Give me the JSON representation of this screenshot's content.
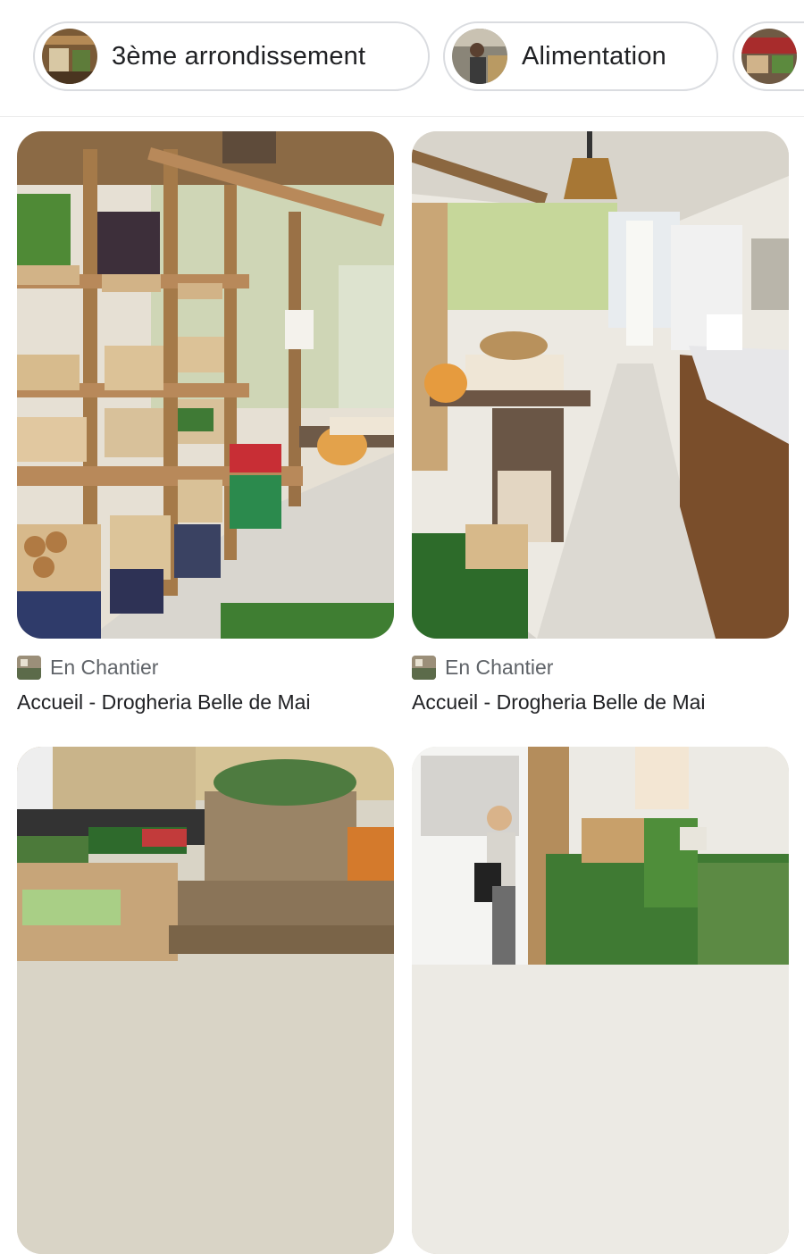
{
  "chips": [
    {
      "label": "3ème arrondissement",
      "thumb": "market-stall-thumbnail"
    },
    {
      "label": "Alimentation",
      "thumb": "grocery-person-thumbnail"
    },
    {
      "label": "",
      "thumb": "produce-thumbnail"
    }
  ],
  "cards": [
    {
      "source": "En Chantier",
      "title": "Accueil - Drogheria Belle de Mai",
      "image": "wooden-shelves-shop-interior"
    },
    {
      "source": "En Chantier",
      "title": "Accueil - Drogheria Belle de Mai",
      "image": "shop-aisle-counter"
    },
    {
      "source": "",
      "title": "",
      "image": "vegetable-crates-in-van"
    },
    {
      "source": "",
      "title": "",
      "image": "woman-at-vegetable-stall"
    }
  ],
  "colors": {
    "chip_border": "#dadce0",
    "title_text": "#202124",
    "secondary_text": "#5f6368"
  }
}
